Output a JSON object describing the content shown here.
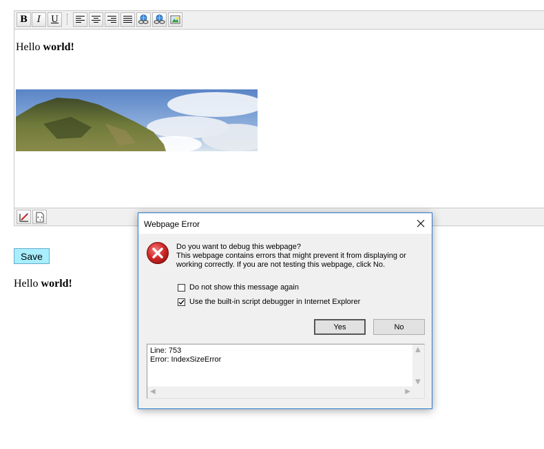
{
  "editor": {
    "toolbar": {
      "bold_icon": "bold-icon",
      "italic_icon": "italic-icon",
      "underline_icon": "underline-icon",
      "bold_glyph": "B",
      "italic_glyph": "I",
      "underline_glyph": "U",
      "align_icons": [
        "align-left-icon",
        "align-center-icon",
        "align-right-icon",
        "align-justify-icon"
      ],
      "link_icons": [
        "insert-link-icon",
        "remove-link-icon",
        "insert-image-icon"
      ]
    },
    "content": {
      "text_plain": "Hello ",
      "text_bold": "world!"
    },
    "statusbar_icons": [
      "design-mode-icon",
      "html-source-icon"
    ]
  },
  "save_button": "Save",
  "preview": {
    "text_plain": "Hello ",
    "text_bold": "world!"
  },
  "dialog": {
    "title": "Webpage Error",
    "icon": "error-icon",
    "question": "Do you want to debug this webpage?",
    "message_line1": "This webpage contains errors that might prevent it from displaying or",
    "message_line2": "working correctly. If you are not testing this webpage, click No.",
    "checkbox_dont_show": {
      "label": "Do not show this message again",
      "checked": false
    },
    "checkbox_debugger": {
      "label": "Use the built-in script debugger in Internet Explorer",
      "checked": true
    },
    "yes_label": "Yes",
    "no_label": "No",
    "details_line1": "Line: 753",
    "details_line2": "Error: IndexSizeError"
  },
  "colors": {
    "save_bg": "#a8eefc",
    "dialog_border": "#2b79d0",
    "error_red": "#d42b2b"
  }
}
